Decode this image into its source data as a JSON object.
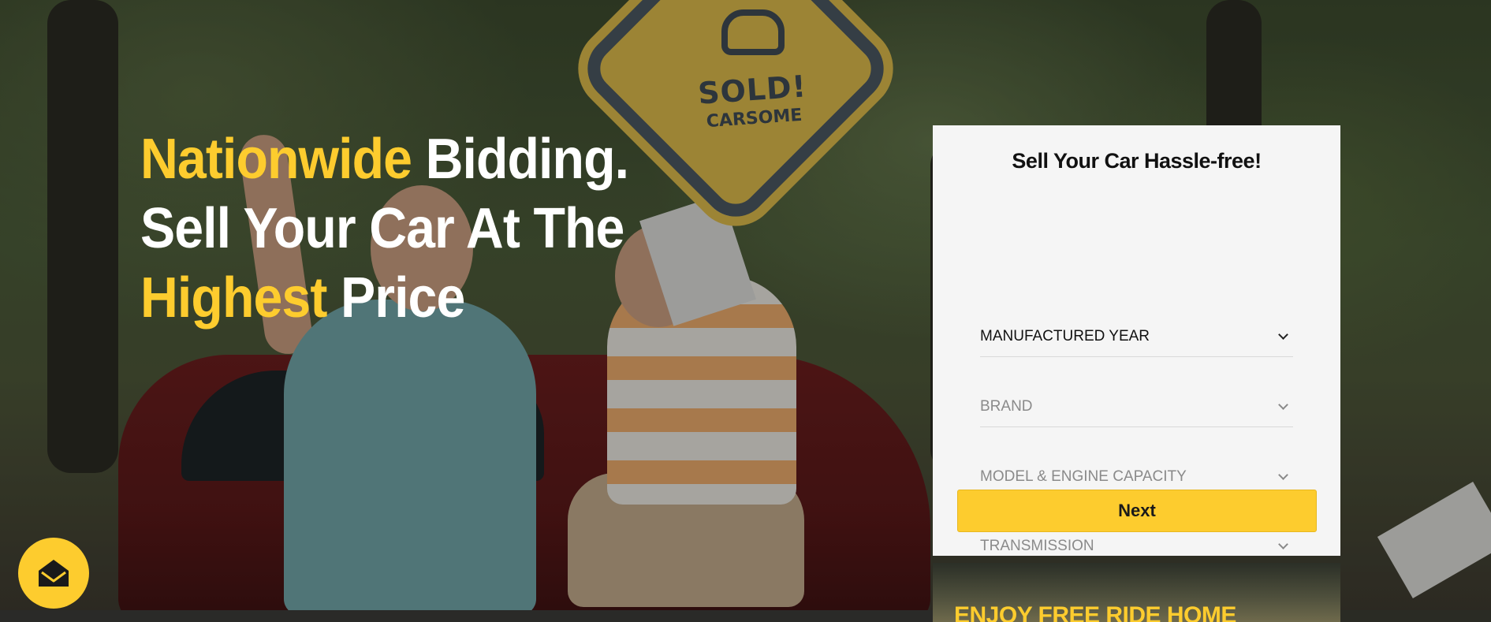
{
  "hero": {
    "headline": {
      "line1_accent": "Nationwide",
      "line1_rest": " Bidding.",
      "line2": "Sell Your Car At The",
      "line3_accent": "Highest",
      "line3_rest": " Price"
    },
    "sign": {
      "text_sold": "SOLD!",
      "text_brand": "CARSOME"
    }
  },
  "form": {
    "title": "Sell Your Car Hassle-free!",
    "fields": [
      {
        "label": "MANUFACTURED YEAR"
      },
      {
        "label": "BRAND"
      },
      {
        "label": "MODEL & ENGINE CAPACITY"
      },
      {
        "label": "TRANSMISSION"
      }
    ],
    "next_label": "Next"
  },
  "promo": {
    "text": "ENJOY FREE RIDE HOME"
  },
  "icons": {
    "mail": "mail-icon",
    "chevron": "chevron-down-icon"
  },
  "colors": {
    "accent": "#fdcc2e",
    "card_bg": "#f5f5f5",
    "text_dark": "#111111",
    "text_muted": "#8a8a8a"
  }
}
